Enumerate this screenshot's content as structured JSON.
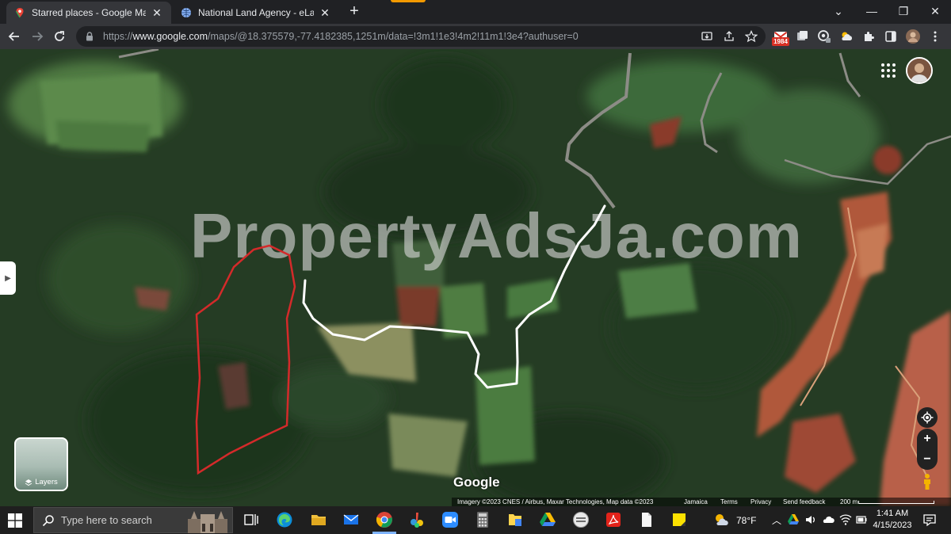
{
  "browser": {
    "tabs": [
      {
        "title": "Starred places - Google Maps",
        "active": true
      },
      {
        "title": "National Land Agency - eLandjamaica",
        "active": false
      }
    ],
    "url_prefix": "https://",
    "url_host": "www.google.com",
    "url_path": "/maps/@18.375579,-77.4182385,1251m/data=!3m1!1e3!4m2!11m1!3e4?authuser=0",
    "extension_badge": "1984"
  },
  "map": {
    "watermark": "PropertyAdsJa.com",
    "layers_label": "Layers",
    "google_logo": "Google",
    "attribution": {
      "imagery": "Imagery ©2023 CNES / Airbus, Maxar Technologies, Map data ©2023",
      "region": "Jamaica",
      "terms": "Terms",
      "privacy": "Privacy",
      "feedback": "Send feedback",
      "scale": "200 m"
    },
    "colors": {
      "boundary": "#d42a2a",
      "route": "#ffffff"
    }
  },
  "taskbar": {
    "search_placeholder": "Type here to search",
    "weather": "78°F",
    "time": "1:41 AM",
    "date": "4/15/2023"
  }
}
